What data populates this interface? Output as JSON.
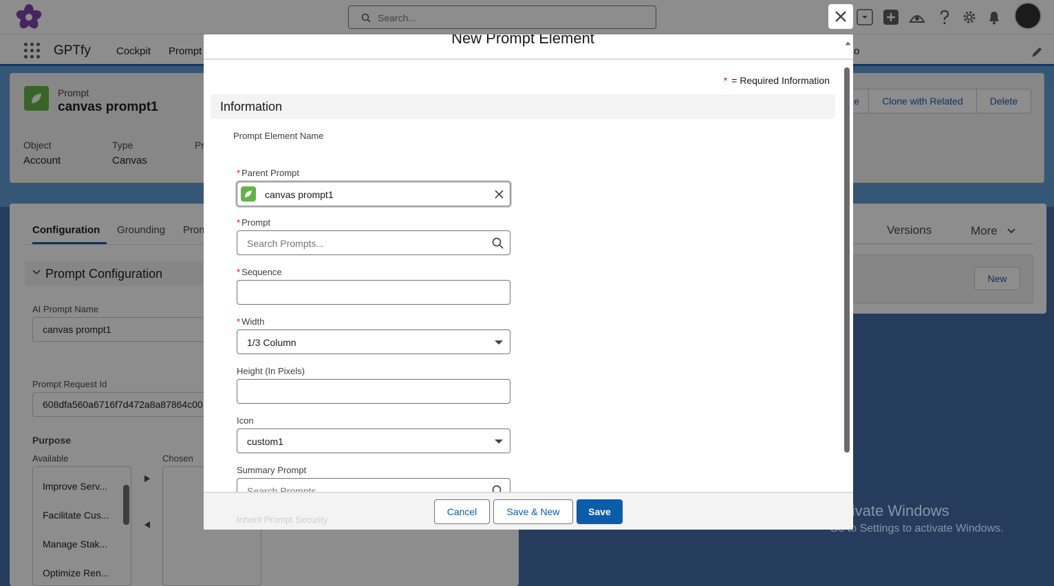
{
  "header": {
    "search_placeholder": "Search...",
    "icons": [
      "close-icon",
      "dropdown-icon",
      "add-icon",
      "trailhead-icon",
      "help-icon",
      "gear-icon",
      "bell-icon",
      "avatar"
    ]
  },
  "nav": {
    "app_name": "GPTfy",
    "items": [
      "Cockpit",
      "Prompt"
    ],
    "trailing_fragment": "o"
  },
  "record": {
    "type": "Prompt",
    "title": "canvas prompt1",
    "fields": [
      {
        "label": "Object",
        "value": "Account"
      },
      {
        "label": "Type",
        "value": "Canvas"
      },
      {
        "label": "Pr",
        "value": ""
      }
    ],
    "actions": [
      "e",
      "Clone with Related",
      "Delete"
    ]
  },
  "left_panel": {
    "tabs": [
      "Configuration",
      "Grounding",
      "Prom"
    ],
    "section": "Prompt Configuration",
    "ai_prompt_name_label": "AI Prompt Name",
    "ai_prompt_name": "canvas prompt1",
    "prompt_request_id_label": "Prompt Request Id",
    "prompt_request_id": "608dfa560a6716f7d472a8a87864c00",
    "purpose_label": "Purpose",
    "available_label": "Available",
    "chosen_label": "Chosen",
    "available_items": [
      "Improve Serv...",
      "Facilitate Cus...",
      "Manage Stak...",
      "Optimize Ren..."
    ]
  },
  "right_panel": {
    "tabs": [
      "Versions",
      "More"
    ],
    "new_button": "New"
  },
  "modal": {
    "title": "New Prompt Element",
    "required_info": "= Required Information",
    "section": "Information",
    "prompt_element_name_label": "Prompt Element Name",
    "parent_prompt": {
      "label": "Parent Prompt",
      "value": "canvas prompt1"
    },
    "prompt": {
      "label": "Prompt",
      "placeholder": "Search Prompts..."
    },
    "sequence": {
      "label": "Sequence",
      "value": ""
    },
    "width": {
      "label": "Width",
      "value": "1/3 Column"
    },
    "height": {
      "label": "Height (In Pixels)",
      "value": ""
    },
    "icon": {
      "label": "Icon",
      "value": "custom1"
    },
    "summary_prompt": {
      "label": "Summary Prompt",
      "placeholder": "Search Prompts..."
    },
    "inherit_label": "Inherit Prompt Security",
    "buttons": {
      "cancel": "Cancel",
      "save_new": "Save & New",
      "save": "Save"
    }
  },
  "watermark": {
    "line1": "Activate Windows",
    "line2": "Go to Settings to activate Windows."
  },
  "colors": {
    "brand": "#0b5cab",
    "required": "#ea001e",
    "prompt_icon": "#62b346",
    "app_background": "#3f6aa6"
  }
}
